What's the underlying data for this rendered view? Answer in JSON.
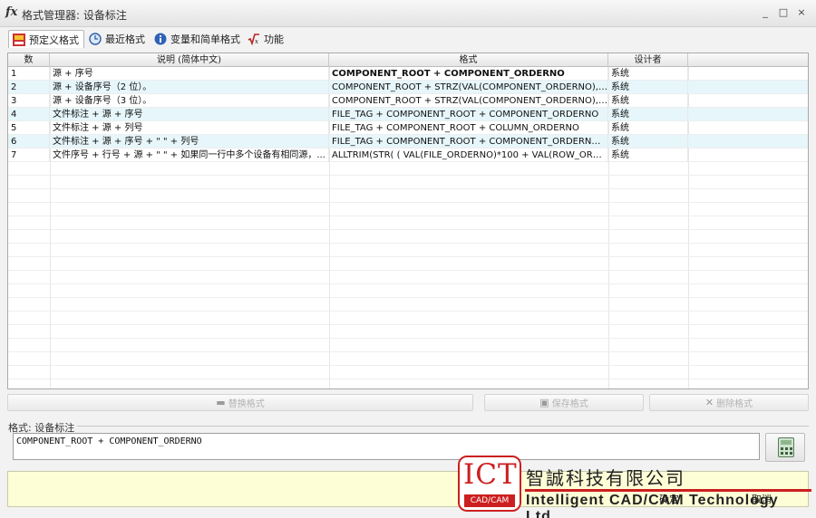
{
  "window": {
    "title_icon": "fx",
    "title": "格式管理器: 设备标注",
    "controls": [
      "_",
      "□",
      "×"
    ]
  },
  "tabs": [
    {
      "label": "预定义格式",
      "icon": "predefined-format-icon",
      "active": true
    },
    {
      "label": "最近格式",
      "icon": "recent-clock-icon",
      "active": false
    },
    {
      "label": "变量和简单格式",
      "icon": "info-icon",
      "active": false
    },
    {
      "label": "功能",
      "icon": "function-sqrt-icon",
      "active": false
    }
  ],
  "table": {
    "columns": [
      "数",
      "说明 (简体中文)",
      "格式",
      "设计者"
    ],
    "rows": [
      {
        "num": "1",
        "desc": "源 + 序号",
        "format": "COMPONENT_ROOT + COMPONENT_ORDERNO",
        "designer": "系统"
      },
      {
        "num": "2",
        "desc": "源 + 设备序号（2 位）。",
        "format": "COMPONENT_ROOT + STRZ(VAL(COMPONENT_ORDERNO), 2, 0)",
        "designer": "系统"
      },
      {
        "num": "3",
        "desc": "源 + 设备序号（3 位）。",
        "format": "COMPONENT_ROOT + STRZ(VAL(COMPONENT_ORDERNO), 3, 0)",
        "designer": "系统"
      },
      {
        "num": "4",
        "desc": "文件标注 + 源 + 序号",
        "format": "FILE_TAG + COMPONENT_ROOT + COMPONENT_ORDERNO",
        "designer": "系统"
      },
      {
        "num": "5",
        "desc": "文件标注 + 源 + 列号",
        "format": "FILE_TAG + COMPONENT_ROOT + COLUMN_ORDERNO",
        "designer": "系统"
      },
      {
        "num": "6",
        "desc": "文件标注 + 源 + 序号 + \" \" + 列号",
        "format": "FILE_TAG + COMPONENT_ROOT + COMPONENT_ORDERNO + \" \" + ...",
        "designer": "系统"
      },
      {
        "num": "7",
        "desc": "文件序号 + 行号 + 源 + \" \" + 如果同一行中多个设备有相同源，...",
        "format": "ALLTRIM(STR( ( VAL(FILE_ORDERNO)*100 + VAL(ROW_ORDERNO) )...",
        "designer": "系统"
      }
    ],
    "selected_row": 1
  },
  "actions": {
    "replace": "替换格式",
    "save": "保存格式",
    "delete": "删除格式"
  },
  "format_panel": {
    "label": "格式: 设备标注",
    "value": "COMPONENT_ROOT + COMPONENT_ORDERNO"
  },
  "footer": {
    "ok": "确定",
    "cancel": "取消"
  },
  "logo": {
    "ict": "ICT",
    "cadcam": "CAD/CAM",
    "chinese_name": "智誠科技有限公司",
    "english_name": "Intelligent CAD/CAM Technology Ltd."
  },
  "colors": {
    "selected_row": "#e6f6fb",
    "status_bg": "#fdfdd6",
    "logo_red": "#cc1f1f"
  }
}
